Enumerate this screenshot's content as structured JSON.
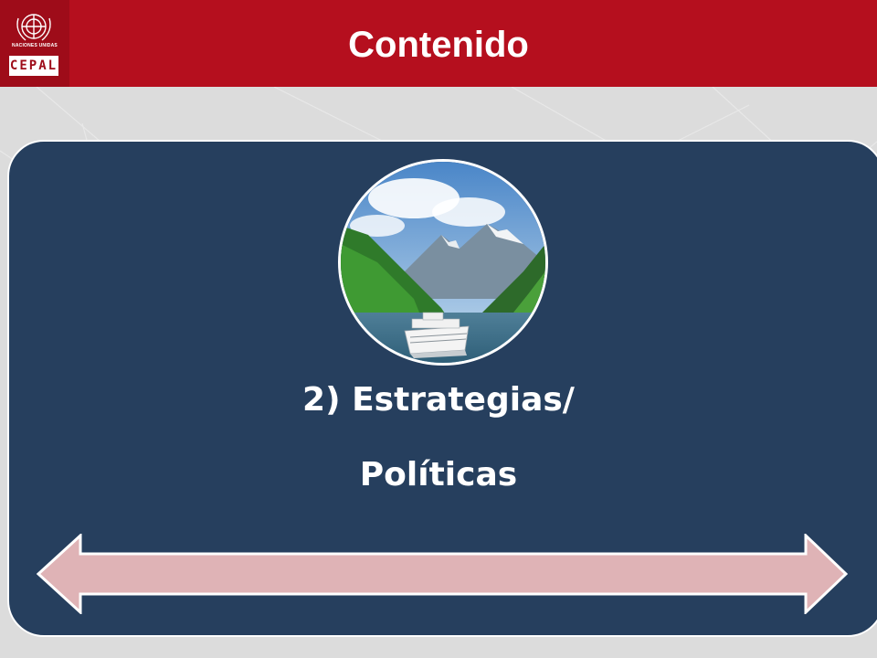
{
  "header": {
    "title": "Contenido",
    "logo": {
      "icon": "un-emblem-icon",
      "org_small": "NACIONES UNIDAS",
      "org": "CEPAL"
    },
    "color": "#b50f1e"
  },
  "card": {
    "heading_line1": "2) Estrategias/",
    "heading_line2": "Políticas",
    "photo_icon": "fjord-cruise-ship-photo",
    "panel_color": "#263f5e"
  },
  "arrow": {
    "icon": "double-headed-arrow-icon",
    "fill": "#dfb3b6"
  }
}
